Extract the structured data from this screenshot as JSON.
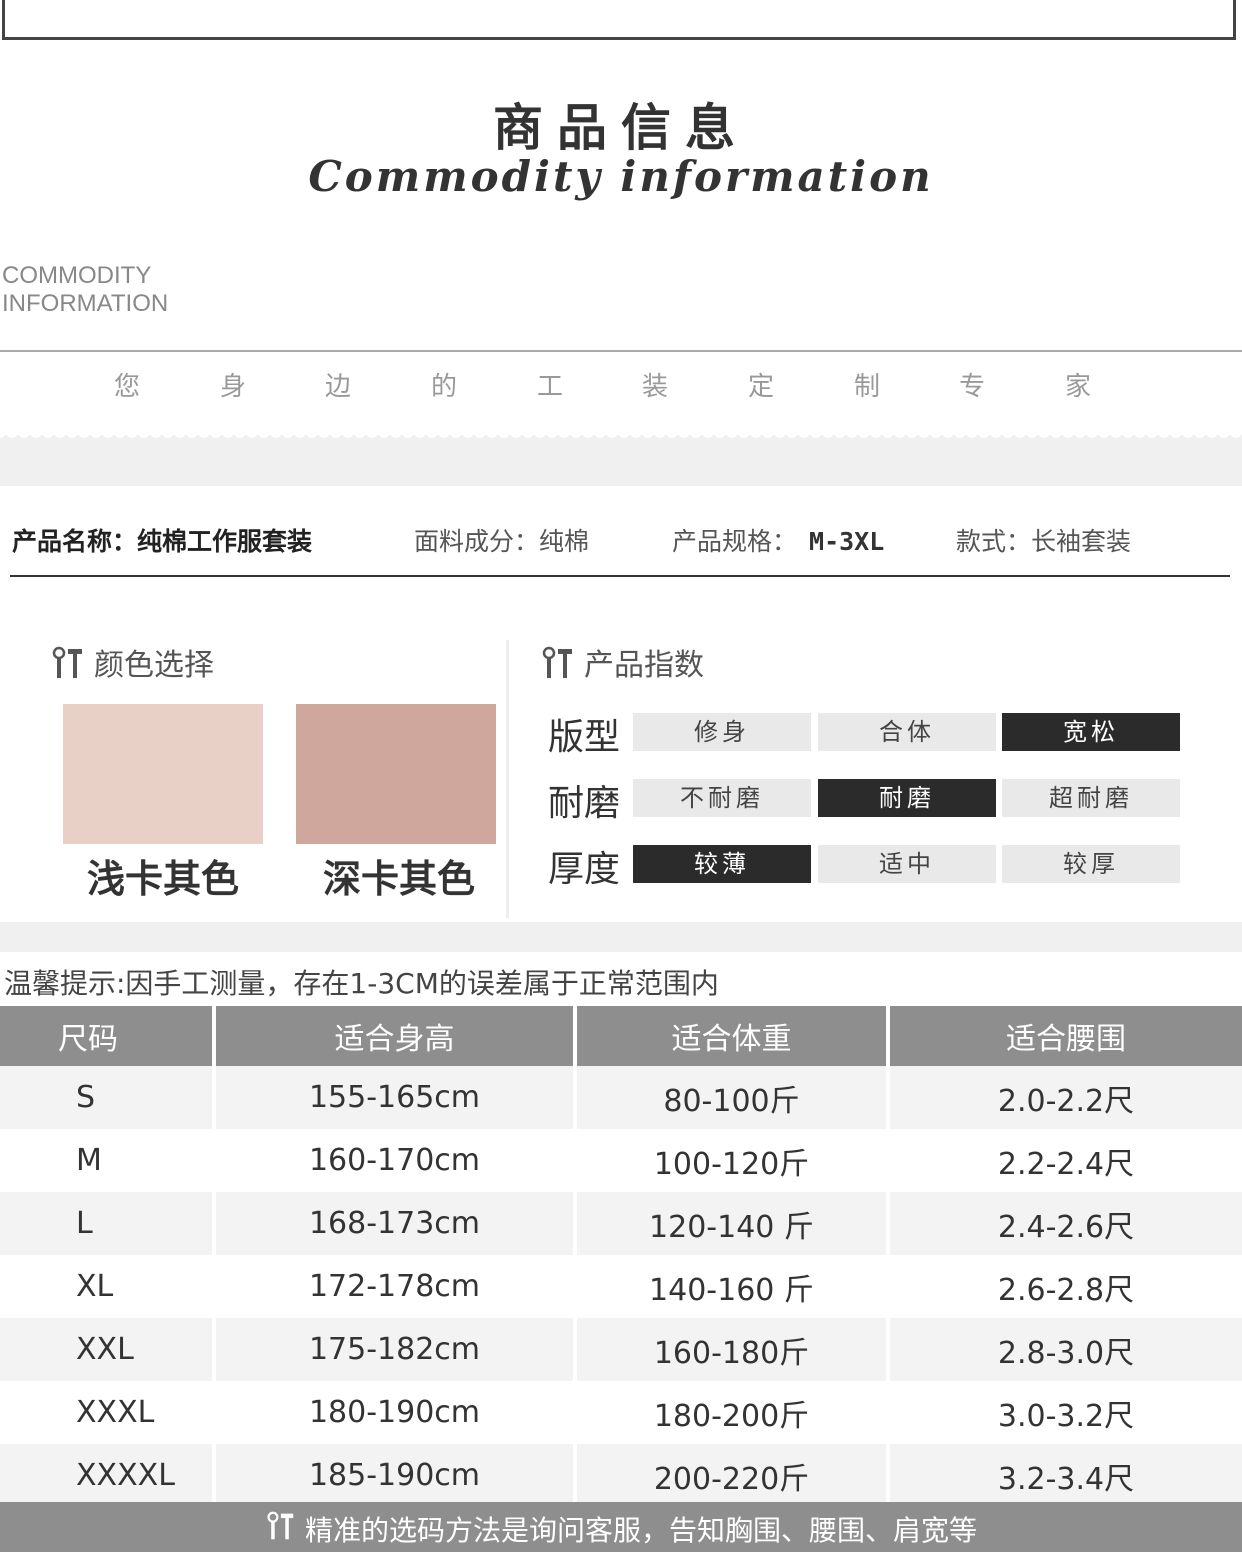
{
  "heading": {
    "title_cn": "商品信息",
    "title_en": "Commodity information",
    "side_label_line1": "COMMODITY",
    "side_label_line2": "INFORMATION"
  },
  "slogan": [
    "您",
    "身",
    "边",
    "的",
    "工",
    "装",
    "定",
    "制",
    "专",
    "家"
  ],
  "product_info": {
    "name": "产品名称：纯棉工作服套装",
    "fabric": "面料成分：纯棉",
    "spec_label": "产品规格：",
    "spec_value": "M-3XL",
    "style": "款式：长袖套装"
  },
  "color_section": {
    "title": "颜色选择",
    "swatches": [
      {
        "label": "浅卡其色",
        "color": "#e8d0c6"
      },
      {
        "label": "深卡其色",
        "color": "#cfa79c"
      }
    ]
  },
  "index_section": {
    "title": "产品指数",
    "rows": [
      {
        "label": "版型",
        "options": [
          "修身",
          "合体",
          "宽松"
        ],
        "selected": 2
      },
      {
        "label": "耐磨",
        "options": [
          "不耐磨",
          "耐磨",
          "超耐磨"
        ],
        "selected": 1
      },
      {
        "label": "厚度",
        "options": [
          "较薄",
          "适中",
          "较厚"
        ],
        "selected": 0
      }
    ]
  },
  "tip": "温馨提示:因手工测量，存在1-3CM的误差属于正常范围内",
  "size_table": {
    "headers": [
      "尺码",
      "适合身高",
      "适合体重",
      "适合腰围"
    ],
    "rows": [
      [
        "S",
        "155-165cm",
        "80-100斤",
        "2.0-2.2尺"
      ],
      [
        "M",
        "160-170cm",
        "100-120斤",
        "2.2-2.4尺"
      ],
      [
        "L",
        "168-173cm",
        "120-140 斤",
        "2.4-2.6尺"
      ],
      [
        "XL",
        "172-178cm",
        "140-160 斤",
        "2.6-2.8尺"
      ],
      [
        "XXL",
        "175-182cm",
        "160-180斤",
        "2.8-3.0尺"
      ],
      [
        "XXXL",
        "180-190cm",
        "180-200斤",
        "3.0-3.2尺"
      ],
      [
        "XXXXL",
        "185-190cm",
        "200-220斤",
        "3.2-3.4尺"
      ]
    ]
  },
  "footer": "精准的选码方法是询问客服，告知胸围、腰围、肩宽等",
  "colors": {
    "header_gray": "#8e8e8e",
    "selected_dark": "#2b2b2b",
    "option_gray": "#e9e9e9"
  },
  "icons": [
    "tools-icon"
  ]
}
